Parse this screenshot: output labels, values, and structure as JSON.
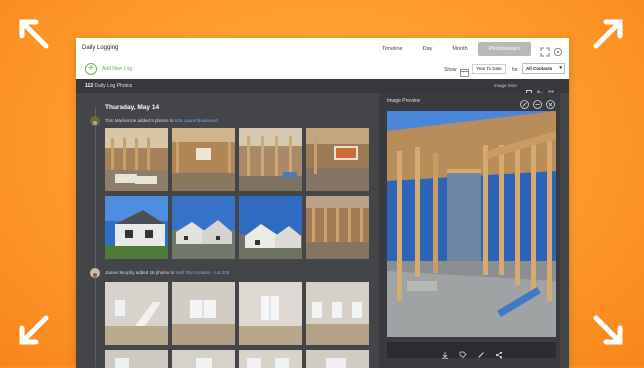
{
  "app": {
    "title": "Daily Logging"
  },
  "tabs": [
    {
      "label": "Timeline",
      "active": false
    },
    {
      "label": "Day",
      "active": false
    },
    {
      "label": "Month",
      "active": false
    },
    {
      "label": "Photostream",
      "active": true
    }
  ],
  "toolbar": {
    "add_label": "Add New Log",
    "show_label": "Show",
    "date_range": "Year To Date",
    "for_label": "for",
    "contact_filter": "All Contacts"
  },
  "photos_header": {
    "count": "113",
    "count_label": "Daily Log Photos",
    "image_size_label": "Image Size:"
  },
  "feed": {
    "day": "Thursday, May 14",
    "posts": [
      {
        "author": "Tom Mackenzie",
        "text": "added 8 photos to",
        "project": "615 Laurel Boulevard"
      },
      {
        "author": "James Murphy",
        "text": "added 26 photos to",
        "project": "Wolf Run Estates - Lot 205"
      }
    ]
  },
  "preview": {
    "title": "Image Preview"
  },
  "colors": {
    "background": "#ff9a2a",
    "accent_green": "#6db34a",
    "link_blue": "#6fb0e8",
    "panel": "#444548"
  }
}
